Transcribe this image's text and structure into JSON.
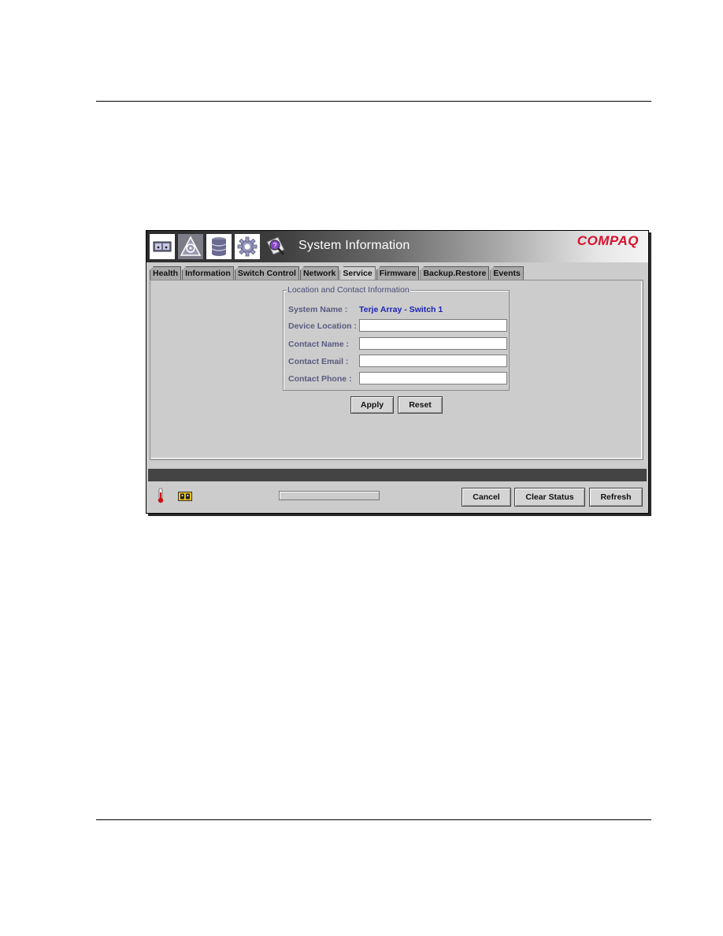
{
  "window": {
    "title": "System Information",
    "brand": "COMPAQ",
    "nav_icons": [
      {
        "name": "hardware-view-icon",
        "active": false
      },
      {
        "name": "topology-icon",
        "active": true
      },
      {
        "name": "storage-icon",
        "active": false
      },
      {
        "name": "settings-gear-icon",
        "active": false
      },
      {
        "name": "system-info-icon",
        "active": false
      }
    ]
  },
  "tabs": [
    {
      "label": "Health",
      "active": false
    },
    {
      "label": "Information",
      "active": false
    },
    {
      "label": "Switch Control",
      "active": false
    },
    {
      "label": "Network",
      "active": false
    },
    {
      "label": "Service",
      "active": true
    },
    {
      "label": "Firmware",
      "active": false
    },
    {
      "label": "Backup.Restore",
      "active": false
    },
    {
      "label": "Events",
      "active": false
    }
  ],
  "form": {
    "legend": "Location and Contact Information",
    "system_name_label": "System Name :",
    "system_name_value": "Terje Array - Switch 1",
    "fields": [
      {
        "label": "Device Location :",
        "value": ""
      },
      {
        "label": "Contact Name :",
        "value": ""
      },
      {
        "label": "Contact Email :",
        "value": ""
      },
      {
        "label": "Contact Phone :",
        "value": ""
      }
    ],
    "apply_label": "Apply",
    "reset_label": "Reset"
  },
  "footer": {
    "status_text": "",
    "progress": 0,
    "icons": [
      "temperature-icon",
      "power-supply-icon"
    ],
    "cancel_label": "Cancel",
    "clear_status_label": "Clear Status",
    "refresh_label": "Refresh"
  }
}
